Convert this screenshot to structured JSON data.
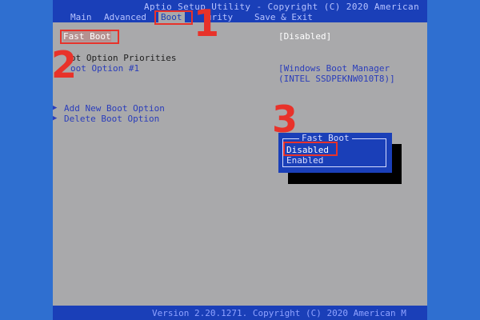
{
  "header": {
    "title": "Aptio Setup Utility - Copyright (C) 2020 American",
    "tabs": [
      "Main",
      "Advanced",
      "Boot",
      "Security",
      "Save & Exit"
    ],
    "active_tab": "Boot",
    "security_visible": "urity"
  },
  "boot": {
    "fast_boot_label": "Fast Boot",
    "fast_boot_value": "[Disabled]",
    "priorities_label": "Boot Option Priorities",
    "priorities_visible": "ot Option Priorities",
    "option1_label": "Boot Option #1",
    "option1_visible": "oot Option #1",
    "option1_value_line1": "[Windows Boot Manager",
    "option1_value_line2": "(INTEL SSDPEKNW010T8)]",
    "add_option": "Add New Boot Option",
    "delete_option": "Delete Boot Option"
  },
  "popup": {
    "title": "Fast Boot",
    "options": [
      "Disabled",
      "Enabled"
    ],
    "selected": "Disabled"
  },
  "annotations": {
    "step1": "1",
    "step2": "2",
    "step3": "3"
  },
  "footer": {
    "version": "Version 2.20.1271. Copyright (C) 2020 American M"
  },
  "colors": {
    "frame": "#2f6fd0",
    "bios_blue": "#1a3fb8",
    "bios_gray": "#a9a9ab",
    "annotation_red": "#e8322a"
  }
}
